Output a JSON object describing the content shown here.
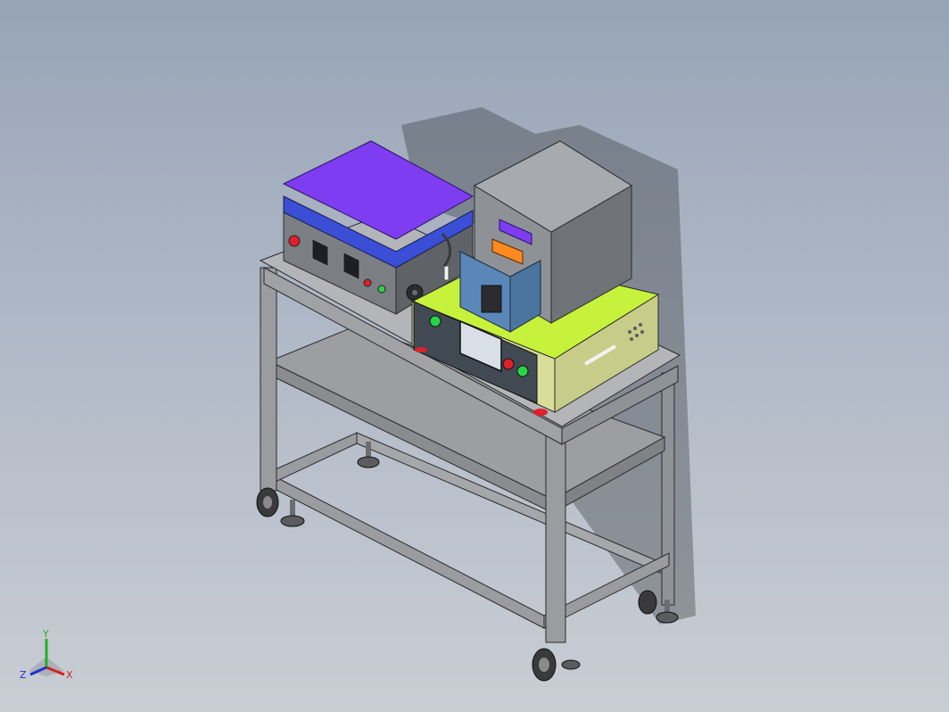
{
  "viewport": {
    "background_top": "#97a4b8",
    "background_bottom": "#c9cdd4"
  },
  "model": {
    "colors": {
      "frame": "#8f9296",
      "frame_edge": "#2a2a2a",
      "shelf": "#9c9ea1",
      "purple_lid": "#7f3df2",
      "blue_body": "#3a4fd6",
      "machine_gray": "#7b7f83",
      "lime_top": "#c6f23c",
      "yellow_body": "#d8de9a",
      "panel_dark": "#414a52",
      "blue_guard": "#5a87b8",
      "orange_part": "#ff8a1f",
      "light_green": "#27d645",
      "light_red": "#e0202a"
    },
    "icons": [
      "caster-wheel-icon",
      "leveling-foot-icon",
      "touchscreen-icon",
      "indicator-light-icon",
      "handle-icon"
    ]
  },
  "triad": {
    "y_label": "Y",
    "x_label": "X",
    "z_label": "Z",
    "y_color": "#20b020",
    "x_color": "#d02020",
    "z_color": "#2030d0"
  }
}
